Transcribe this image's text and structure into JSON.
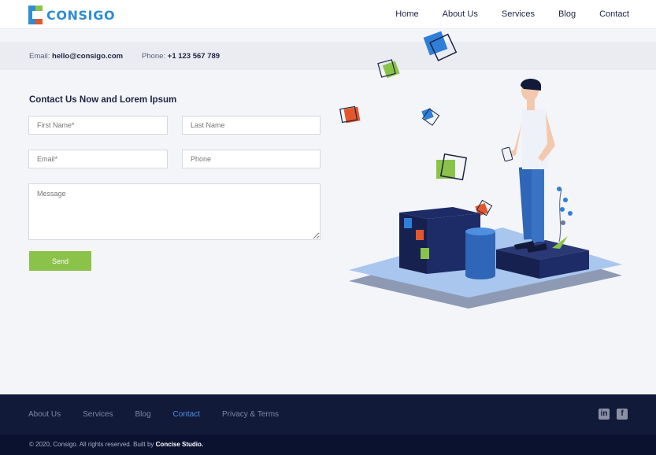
{
  "brand": {
    "name": "CONSIGO",
    "colors": {
      "blue": "#2f8dd0",
      "green": "#8bc34a",
      "orange": "#e4572e",
      "navy": "#111a39"
    }
  },
  "nav": {
    "items": [
      {
        "label": "Home",
        "active": false
      },
      {
        "label": "About Us",
        "active": false
      },
      {
        "label": "Services",
        "active": false
      },
      {
        "label": "Blog",
        "active": false
      },
      {
        "label": "Contact",
        "active": true
      }
    ]
  },
  "info": {
    "email_label": "Email:",
    "email_value": "hello@consigo.com",
    "phone_label": "Phone:",
    "phone_value": "+1 123 567 789"
  },
  "form": {
    "title": "Contact Us Now and Lorem Ipsum",
    "first_name_placeholder": "First Name*",
    "last_name_placeholder": "Last Name",
    "email_placeholder": "Email*",
    "phone_placeholder": "Phone",
    "message_placeholder": "Message",
    "send_label": "Send"
  },
  "footer": {
    "links": [
      {
        "label": "About Us",
        "active": false
      },
      {
        "label": "Services",
        "active": false
      },
      {
        "label": "Blog",
        "active": false
      },
      {
        "label": "Contact",
        "active": true
      },
      {
        "label": "Privacy & Terms",
        "active": false
      }
    ],
    "social": [
      "linkedin-icon",
      "facebook-icon"
    ],
    "copyright_prefix": "© 2020, Consigo. All rights reserved. Built by",
    "copyright_studio": "Concise Studio."
  }
}
